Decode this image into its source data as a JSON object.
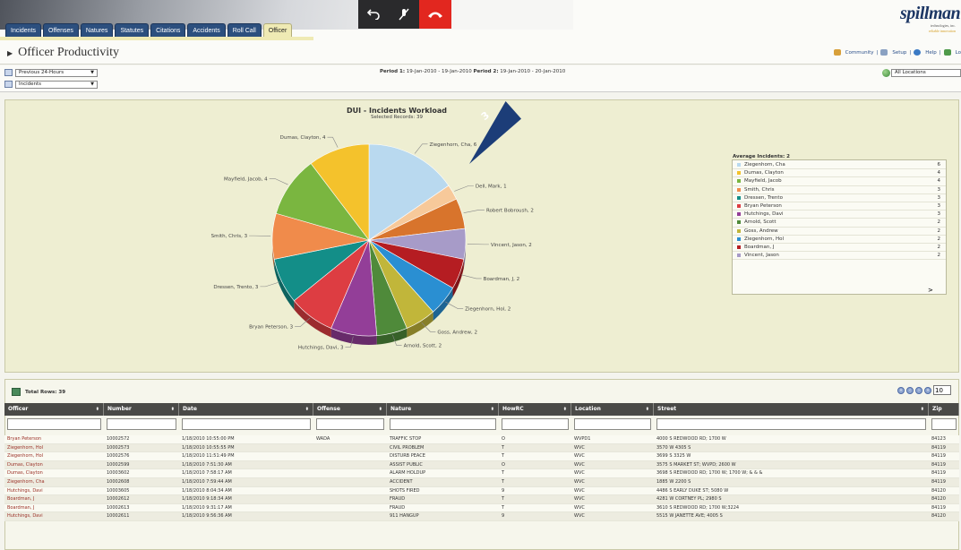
{
  "nav": {
    "tabs": [
      {
        "label": "Incidents",
        "active": false
      },
      {
        "label": "Offenses",
        "active": false
      },
      {
        "label": "Natures",
        "active": false
      },
      {
        "label": "Statutes",
        "active": false
      },
      {
        "label": "Citations",
        "active": false
      },
      {
        "label": "Accidents",
        "active": false
      },
      {
        "label": "Roll Call",
        "active": false
      },
      {
        "label": "Officer",
        "active": true
      }
    ]
  },
  "call_controls": {
    "back_icon": "return-arrow-icon",
    "mute_icon": "mic-off-icon",
    "hangup_icon": "hang-up-icon"
  },
  "logo": {
    "name": "spillman",
    "sub1": "technologies, inc.",
    "sub2": "reliable innovation"
  },
  "page": {
    "title": "Officer Productivity",
    "links": [
      "Community",
      "Setup",
      "Help",
      "Lo"
    ]
  },
  "filters": {
    "period_select": "Previous 24-Hours",
    "type_select": "Incidents",
    "period1_label": "Period 1:",
    "period1_value": "19-Jan-2010 - 19-Jan-2010",
    "period2_label": "Period 2:",
    "period2_value": "19-Jan-2010 - 20-Jan-2010",
    "location_select": "All Locations"
  },
  "callout": {
    "number": "3"
  },
  "chart_data": {
    "type": "pie",
    "title": "DUI - Incidents Workload",
    "subtitle": "Selected Records: 39",
    "slices": [
      {
        "label": "Ziegenhorn, Cha, 6",
        "value": 6,
        "color": "#b9d9ef"
      },
      {
        "label": "Dell, Mark, 1",
        "value": 1,
        "color": "#f7c99a"
      },
      {
        "label": "Robert Bobroush, 2",
        "value": 2,
        "color": "#d8742c"
      },
      {
        "label": "Vincent, Jason, 2",
        "value": 2,
        "color": "#a79bc8"
      },
      {
        "label": "Boardman, J, 2",
        "value": 2,
        "color": "#b51d22"
      },
      {
        "label": "Ziegenhorn, Hol, 2",
        "value": 2,
        "color": "#2a8fd2"
      },
      {
        "label": "Goss, Andrew, 2",
        "value": 2,
        "color": "#c1b63a"
      },
      {
        "label": "Arnold, Scott, 2",
        "value": 2,
        "color": "#4f8a3a"
      },
      {
        "label": "Hutchings, Davi, 3",
        "value": 3,
        "color": "#933e98"
      },
      {
        "label": "Bryan Peterson, 3",
        "value": 3,
        "color": "#dd3d42"
      },
      {
        "label": "Dressen, Trento, 3",
        "value": 3,
        "color": "#138e88"
      },
      {
        "label": "Smith, Chris, 3",
        "value": 3,
        "color": "#f08b4b"
      },
      {
        "label": "Mayfield, Jacob, 4",
        "value": 4,
        "color": "#7ab640"
      },
      {
        "label": "Dumas, Clayton, 4",
        "value": 4,
        "color": "#f4c22c"
      }
    ]
  },
  "legend": {
    "title": "Average Incidents: 2",
    "items": [
      {
        "name": "Ziegenhorn, Cha",
        "value": "6",
        "color": "#b9d9ef"
      },
      {
        "name": "Dumas, Clayton",
        "value": "4",
        "color": "#f4c22c"
      },
      {
        "name": "Mayfield, Jacob",
        "value": "4",
        "color": "#7ab640"
      },
      {
        "name": "Smith, Chris",
        "value": "3",
        "color": "#f08b4b"
      },
      {
        "name": "Dressen, Trento",
        "value": "3",
        "color": "#138e88"
      },
      {
        "name": "Bryan Peterson",
        "value": "3",
        "color": "#dd3d42"
      },
      {
        "name": "Hutchings, Davi",
        "value": "3",
        "color": "#933e98"
      },
      {
        "name": "Arnold, Scott",
        "value": "2",
        "color": "#4f8a3a"
      },
      {
        "name": "Goss, Andrew",
        "value": "2",
        "color": "#c1b63a"
      },
      {
        "name": "Ziegenhorn, Hol",
        "value": "2",
        "color": "#2a8fd2"
      },
      {
        "name": "Boardman, J",
        "value": "2",
        "color": "#b51d22"
      },
      {
        "name": "Vincent, Jason",
        "value": "2",
        "color": "#a79bc8"
      }
    ],
    "next": ">"
  },
  "grid": {
    "total_rows": "Total Rows: 39",
    "page_size": "10",
    "columns": [
      "Officer",
      "Number",
      "Date",
      "Offense",
      "Nature",
      "HowRC",
      "Location",
      "Street",
      "Zip"
    ],
    "rows": [
      [
        "Bryan Peterson",
        "10002572",
        "1/18/2010 10:55:00 PM",
        "WADA",
        "TRAFFIC STOP",
        "O",
        "WVPD1",
        "4000 S REDWOOD RD; 1700 W",
        "84123"
      ],
      [
        "Ziegenhorn, Hol",
        "10002573",
        "1/18/2010 10:55:55 PM",
        "",
        "CIVIL PROBLEM",
        "T",
        "WVC",
        "3570 W 4305 S",
        "84119"
      ],
      [
        "Ziegenhorn, Hol",
        "10002576",
        "1/18/2010 11:51:49 PM",
        "",
        "DISTURB PEACE",
        "T",
        "WVC",
        "3699 S 3325 W",
        "84119"
      ],
      [
        "Dumas, Clayton",
        "10002599",
        "1/18/2010 7:51:30 AM",
        "",
        "ASSIST PUBLIC",
        "O",
        "WVC",
        "3575 S MARKET ST; WVPD; 2600 W",
        "84119"
      ],
      [
        "Dumas, Clayton",
        "10003602",
        "1/18/2010 7:58:17 AM",
        "",
        "ALARM HOLDUP",
        "T",
        "WVC",
        "3698 S REDWOOD RD; 1700 W; 1700 W; & & &",
        "84119"
      ],
      [
        "Ziegenhorn, Cha",
        "10002608",
        "1/18/2010 7:59:44 AM",
        "",
        "ACCIDENT",
        "T",
        "WVC",
        "1885 W 2200 S",
        "84119"
      ],
      [
        "Hutchings, Davi",
        "10003605",
        "1/18/2010 8:04:34 AM",
        "",
        "SHOTS FIRED",
        "9",
        "WVC",
        "4486 S EARLY DUKE ST; 5080 W",
        "84120"
      ],
      [
        "Boardman, J",
        "10002612",
        "1/18/2010 9:18:34 AM",
        "",
        "FRAUD",
        "T",
        "WVC",
        "4281 W CORTNEY PL; 2980 S",
        "84120"
      ],
      [
        "Boardman, J",
        "10002613",
        "1/18/2010 9:31:17 AM",
        "",
        "FRAUD",
        "T",
        "WVC",
        "3610 S REDWOOD RD; 1700 W;3224",
        "84119"
      ],
      [
        "Hutchings, Davi",
        "10002611",
        "1/18/2010 9:56:36 AM",
        "",
        "911 HANGUP",
        "9",
        "WVC",
        "5515 W JANETTE AVE; 4005 S",
        "84120"
      ]
    ]
  }
}
